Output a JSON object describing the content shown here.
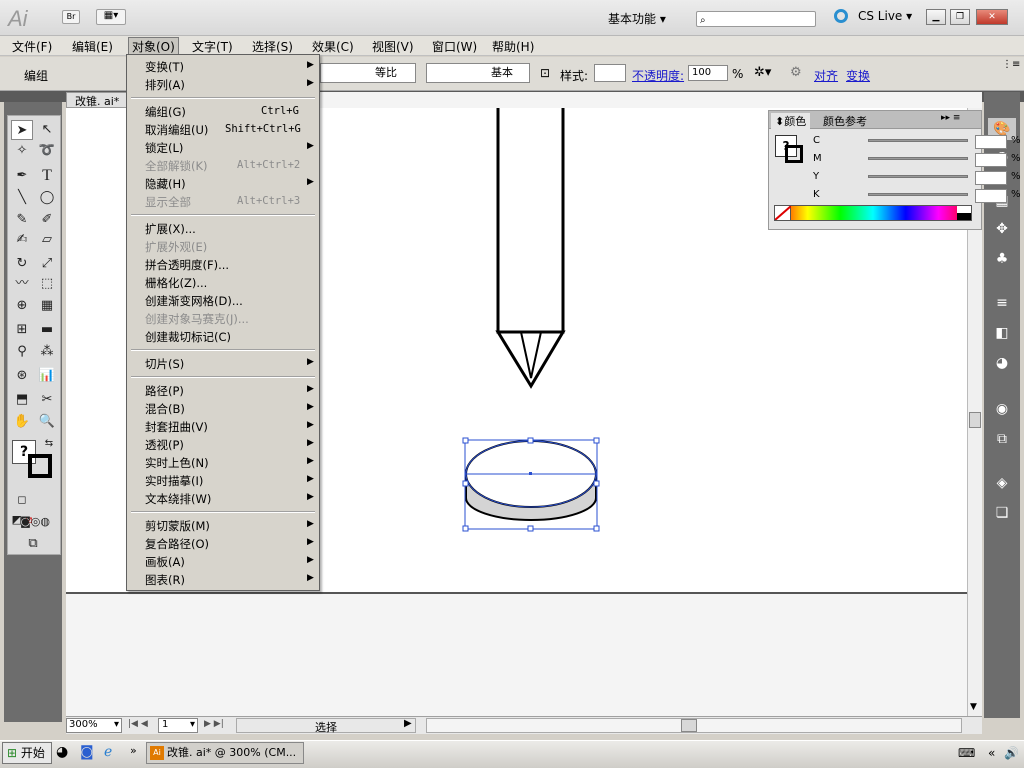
{
  "app": {
    "logo": "Ai",
    "bridge": "Br",
    "workspace": "基本功能",
    "cslive": "CS Live",
    "doc_tab": "改锥. ai*"
  },
  "menubar": [
    "文件(F)",
    "编辑(E)",
    "对象(O)",
    "文字(T)",
    "选择(S)",
    "效果(C)",
    "视图(V)",
    "窗口(W)",
    "帮助(H)"
  ],
  "control": {
    "selection": "编组",
    "stroke_scale": "等比",
    "stroke_style": "基本",
    "style_label": "样式:",
    "opacity_label": "不透明度:",
    "opacity": "100",
    "opacity_unit": "%",
    "align": "对齐",
    "transform": "变换"
  },
  "object_menu": [
    {
      "label": "变换(T)",
      "sub": true
    },
    {
      "label": "排列(A)",
      "sub": true
    },
    {
      "label": "编组(G)",
      "shortcut": "Ctrl+G"
    },
    {
      "label": "取消编组(U)",
      "shortcut": "Shift+Ctrl+G"
    },
    {
      "label": "锁定(L)",
      "sub": true
    },
    {
      "label": "全部解锁(K)",
      "shortcut": "Alt+Ctrl+2",
      "disabled": true
    },
    {
      "label": "隐藏(H)",
      "sub": true
    },
    {
      "label": "显示全部",
      "shortcut": "Alt+Ctrl+3",
      "disabled": true
    },
    {
      "label": "扩展(X)..."
    },
    {
      "label": "扩展外观(E)",
      "disabled": true
    },
    {
      "label": "拼合透明度(F)..."
    },
    {
      "label": "栅格化(Z)..."
    },
    {
      "label": "创建渐变网格(D)..."
    },
    {
      "label": "创建对象马赛克(J)...",
      "disabled": true
    },
    {
      "label": "创建裁切标记(C)"
    },
    {
      "label": "切片(S)",
      "sub": true
    },
    {
      "label": "路径(P)",
      "sub": true
    },
    {
      "label": "混合(B)",
      "sub": true
    },
    {
      "label": "封套扭曲(V)",
      "sub": true
    },
    {
      "label": "透视(P)",
      "sub": true
    },
    {
      "label": "实时上色(N)",
      "sub": true
    },
    {
      "label": "实时描摹(I)",
      "sub": true
    },
    {
      "label": "文本绕排(W)",
      "sub": true
    },
    {
      "label": "剪切蒙版(M)",
      "sub": true
    },
    {
      "label": "复合路径(O)",
      "sub": true
    },
    {
      "label": "画板(A)",
      "sub": true
    },
    {
      "label": "图表(R)",
      "sub": true
    }
  ],
  "color_panel": {
    "tab1": "颜色",
    "tab2": "颜色参考",
    "channels": [
      "C",
      "M",
      "Y",
      "K"
    ],
    "unit": "%"
  },
  "status": {
    "zoom": "300%",
    "page": "1",
    "tool": "选择"
  },
  "taskbar": {
    "start": "开始",
    "task": "改锥. ai* @ 300% (CM..."
  }
}
